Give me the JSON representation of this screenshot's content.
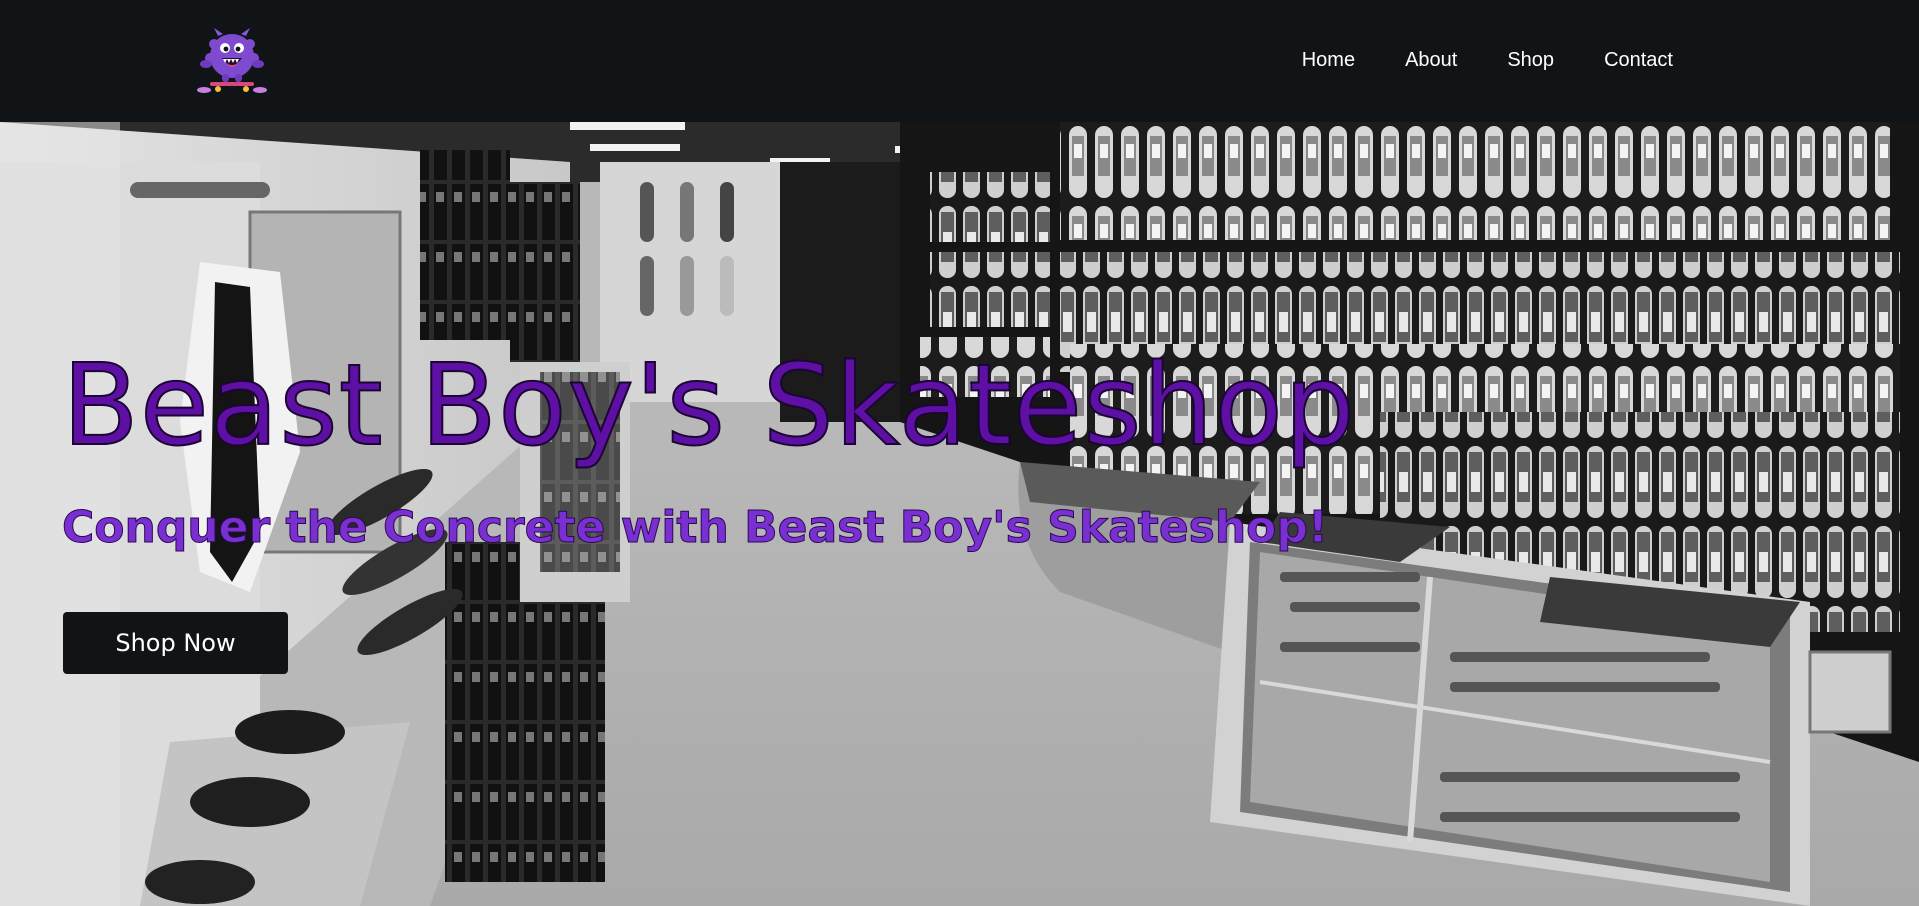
{
  "header": {
    "logo_icon": "purple-monster-skateboard-icon",
    "nav": [
      {
        "label": "Home"
      },
      {
        "label": "About"
      },
      {
        "label": "Shop"
      },
      {
        "label": "Contact"
      }
    ]
  },
  "hero": {
    "title": "Beast Boy's Skateshop",
    "subtitle": "Conquer the Concrete with Beast Boy's Skateshop!",
    "cta_label": "Shop Now",
    "background": "grayscale-skateshop-interior-photo"
  },
  "colors": {
    "nav_bg": "#111417",
    "title_purple": "#5d10a3",
    "subtitle_purple": "#7a2fd0",
    "button_bg": "#111417"
  }
}
